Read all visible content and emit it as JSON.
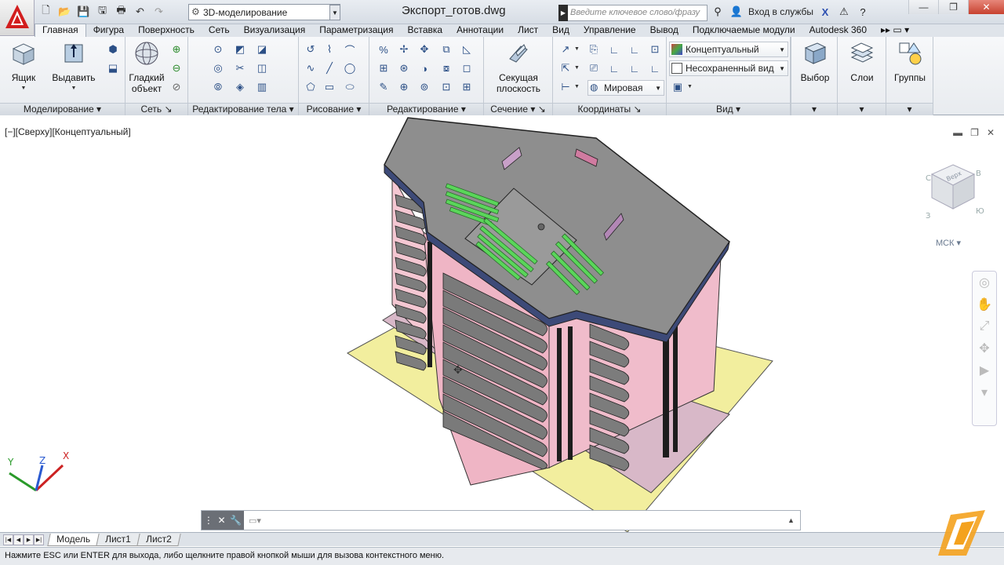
{
  "title_bar": {
    "workspace": "3D-моделирование",
    "document": "Экспорт_готов.dwg",
    "search_placeholder": "Введите ключевое слово/фразу",
    "sign_in": "Вход в службы"
  },
  "tabs": [
    "Главная",
    "Фигура",
    "Поверхность",
    "Сеть",
    "Визуализация",
    "Параметризация",
    "Вставка",
    "Аннотации",
    "Лист",
    "Вид",
    "Управление",
    "Вывод",
    "Подключаемые модули",
    "Autodesk 360"
  ],
  "ribbon": {
    "modeling": {
      "title": "Моделирование",
      "box": "Ящик",
      "extrude": "Выдавить"
    },
    "mesh": {
      "title": "Сеть",
      "smooth_line1": "Гладкий",
      "smooth_line2": "объект"
    },
    "solid_edit": {
      "title": "Редактирование тела"
    },
    "draw": {
      "title": "Рисование"
    },
    "modify": {
      "title": "Редактирование"
    },
    "section": {
      "title": "Сечение",
      "plane_line1": "Секущая",
      "plane_line2": "плоскость"
    },
    "coords": {
      "title": "Координаты",
      "world": "Мировая"
    },
    "view": {
      "title": "Вид",
      "visual_style": "Концептуальный",
      "saved_view": "Несохраненный вид"
    },
    "selection": {
      "label": "Выбор"
    },
    "layers": {
      "label": "Слои"
    },
    "groups": {
      "label": "Группы"
    }
  },
  "viewport": {
    "label": "[−][Сверху][Концептуальный]",
    "ucs": "МСК",
    "viewcube_top": "Верх",
    "viewcube_n": "С",
    "viewcube_e": "В",
    "viewcube_s": "Ю",
    "viewcube_w": "З",
    "axis_x": "X",
    "axis_y": "Y",
    "axis_z": "Z"
  },
  "layout_tabs": [
    "Модель",
    "Лист1",
    "Лист2"
  ],
  "status_text": "Нажмите ESC или ENTER для выхода, либо щелкните правой кнопкой мыши для вызова контекстного меню.",
  "colors": {
    "roof": "#8a8a8a",
    "wall": "#f2c0cc",
    "balcony": "#7a7a7a",
    "base": "#f3ef9e",
    "solar": "#5ad65a",
    "accent": "#cc2222"
  }
}
